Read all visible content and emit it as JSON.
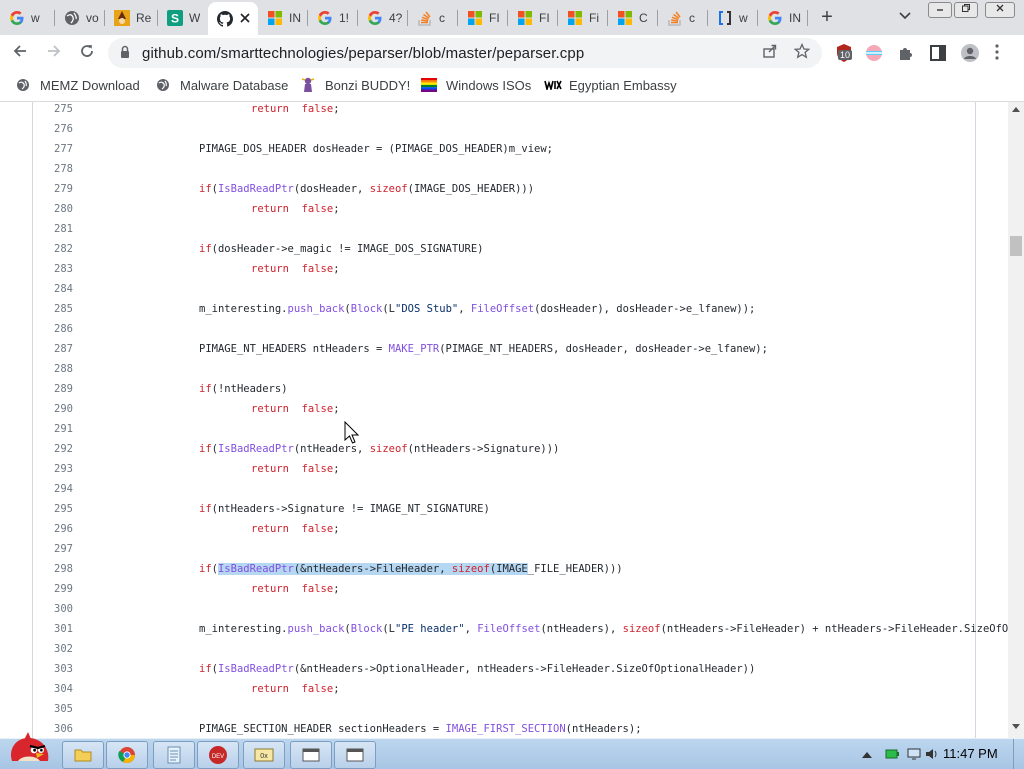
{
  "tabs": [
    {
      "title": "w",
      "icon": "google-icon",
      "active": false
    },
    {
      "title": "vo",
      "icon": "globe-icon",
      "active": false
    },
    {
      "title": "Re",
      "icon": "wizard-icon",
      "active": false
    },
    {
      "title": "W",
      "icon": "s-logo-icon",
      "active": false
    },
    {
      "title": "",
      "icon": "github-icon",
      "active": true
    },
    {
      "title": "IN",
      "icon": "windows-icon",
      "active": false
    },
    {
      "title": "1!",
      "icon": "google-icon",
      "active": false
    },
    {
      "title": "4?",
      "icon": "google-icon",
      "active": false
    },
    {
      "title": "c",
      "icon": "stackoverflow-icon",
      "active": false
    },
    {
      "title": "FI",
      "icon": "windows-icon",
      "active": false
    },
    {
      "title": "FI",
      "icon": "windows-icon",
      "active": false
    },
    {
      "title": "Fi",
      "icon": "windows-icon",
      "active": false
    },
    {
      "title": "C",
      "icon": "windows-icon",
      "active": false
    },
    {
      "title": "c",
      "icon": "stackoverflow-icon",
      "active": false
    },
    {
      "title": "w",
      "icon": "bracket-icon",
      "active": false
    },
    {
      "title": "IN",
      "icon": "google-icon",
      "active": false
    }
  ],
  "toolbar": {
    "url": "github.com/smarttechnologies/peparser/blob/master/peparser.cpp",
    "ext_badge": "10"
  },
  "bookmarks": [
    {
      "label": "MEMZ Download",
      "icon": "globe-icon"
    },
    {
      "label": "Malware Database",
      "icon": "globe-icon"
    },
    {
      "label": "Bonzi BUDDY!",
      "icon": "bonzi-icon"
    },
    {
      "label": "Windows ISOs",
      "icon": "rainbow-flag-icon"
    },
    {
      "label": "Egyptian Embassy",
      "icon": "wix-icon"
    }
  ],
  "code": {
    "lines": [
      {
        "n": "275",
        "indent": 2,
        "segs": [
          [
            "kw",
            "return"
          ],
          [
            "",
            "  "
          ],
          [
            "kw",
            "false"
          ],
          [
            "",
            ";"
          ]
        ]
      },
      {
        "n": "276",
        "indent": 0,
        "segs": []
      },
      {
        "n": "277",
        "indent": 1,
        "segs": [
          [
            "",
            "PIMAGE_DOS_HEADER dosHeader = (PIMAGE_DOS_HEADER)m_view;"
          ]
        ]
      },
      {
        "n": "278",
        "indent": 0,
        "segs": []
      },
      {
        "n": "279",
        "indent": 1,
        "segs": [
          [
            "kw",
            "if"
          ],
          [
            "",
            "("
          ],
          [
            "fn",
            "IsBadReadPtr"
          ],
          [
            "",
            "(dosHeader, "
          ],
          [
            "kw",
            "sizeof"
          ],
          [
            "",
            "(IMAGE_DOS_HEADER)))"
          ]
        ]
      },
      {
        "n": "280",
        "indent": 2,
        "segs": [
          [
            "kw",
            "return"
          ],
          [
            "",
            "  "
          ],
          [
            "kw",
            "false"
          ],
          [
            "",
            ";"
          ]
        ]
      },
      {
        "n": "281",
        "indent": 0,
        "segs": []
      },
      {
        "n": "282",
        "indent": 1,
        "segs": [
          [
            "kw",
            "if"
          ],
          [
            "",
            "(dosHeader->e_magic != IMAGE_DOS_SIGNATURE)"
          ]
        ]
      },
      {
        "n": "283",
        "indent": 2,
        "segs": [
          [
            "kw",
            "return"
          ],
          [
            "",
            "  "
          ],
          [
            "kw",
            "false"
          ],
          [
            "",
            ";"
          ]
        ]
      },
      {
        "n": "284",
        "indent": 0,
        "segs": []
      },
      {
        "n": "285",
        "indent": 1,
        "segs": [
          [
            "",
            "m_interesting."
          ],
          [
            "fn",
            "push_back"
          ],
          [
            "",
            "("
          ],
          [
            "fn",
            "Block"
          ],
          [
            "",
            "(L"
          ],
          [
            "str",
            "\"DOS Stub\""
          ],
          [
            "",
            ", "
          ],
          [
            "fn",
            "FileOffset"
          ],
          [
            "",
            "(dosHeader), dosHeader->e_lfanew));"
          ]
        ]
      },
      {
        "n": "286",
        "indent": 0,
        "segs": []
      },
      {
        "n": "287",
        "indent": 1,
        "segs": [
          [
            "",
            "PIMAGE_NT_HEADERS ntHeaders = "
          ],
          [
            "fn",
            "MAKE_PTR"
          ],
          [
            "",
            "(PIMAGE_NT_HEADERS, dosHeader, dosHeader->e_lfanew);"
          ]
        ]
      },
      {
        "n": "288",
        "indent": 0,
        "segs": []
      },
      {
        "n": "289",
        "indent": 1,
        "segs": [
          [
            "kw",
            "if"
          ],
          [
            "",
            "(!ntHeaders)"
          ]
        ]
      },
      {
        "n": "290",
        "indent": 2,
        "segs": [
          [
            "kw",
            "return"
          ],
          [
            "",
            "  "
          ],
          [
            "kw",
            "false"
          ],
          [
            "",
            ";"
          ]
        ]
      },
      {
        "n": "291",
        "indent": 0,
        "segs": []
      },
      {
        "n": "292",
        "indent": 1,
        "segs": [
          [
            "kw",
            "if"
          ],
          [
            "",
            "("
          ],
          [
            "fn",
            "IsBadReadPtr"
          ],
          [
            "",
            "(ntHeaders, "
          ],
          [
            "kw",
            "sizeof"
          ],
          [
            "",
            "(ntHeaders->Signature)))"
          ]
        ]
      },
      {
        "n": "293",
        "indent": 2,
        "segs": [
          [
            "kw",
            "return"
          ],
          [
            "",
            "  "
          ],
          [
            "kw",
            "false"
          ],
          [
            "",
            ";"
          ]
        ]
      },
      {
        "n": "294",
        "indent": 0,
        "segs": []
      },
      {
        "n": "295",
        "indent": 1,
        "segs": [
          [
            "kw",
            "if"
          ],
          [
            "",
            "(ntHeaders->Signature != IMAGE_NT_SIGNATURE)"
          ]
        ]
      },
      {
        "n": "296",
        "indent": 2,
        "segs": [
          [
            "kw",
            "return"
          ],
          [
            "",
            "  "
          ],
          [
            "kw",
            "false"
          ],
          [
            "",
            ";"
          ]
        ]
      },
      {
        "n": "297",
        "indent": 0,
        "segs": []
      },
      {
        "n": "298",
        "indent": 1,
        "segs": [
          [
            "kw",
            "if"
          ],
          [
            "",
            "("
          ],
          [
            "fn hl",
            "IsBadReadPtr"
          ],
          [
            "hl",
            "(&ntHeaders->FileHeader, "
          ],
          [
            "kw hl",
            "sizeof"
          ],
          [
            "hl",
            "(IMAGE"
          ],
          [
            "",
            "_FILE_HEADER)))"
          ]
        ]
      },
      {
        "n": "299",
        "indent": 2,
        "segs": [
          [
            "kw",
            "return"
          ],
          [
            "",
            "  "
          ],
          [
            "kw",
            "false"
          ],
          [
            "",
            ";"
          ]
        ]
      },
      {
        "n": "300",
        "indent": 0,
        "segs": []
      },
      {
        "n": "301",
        "indent": 1,
        "segs": [
          [
            "",
            "m_interesting."
          ],
          [
            "fn",
            "push_back"
          ],
          [
            "",
            "("
          ],
          [
            "fn",
            "Block"
          ],
          [
            "",
            "(L"
          ],
          [
            "str",
            "\"PE header\""
          ],
          [
            "",
            ", "
          ],
          [
            "fn",
            "FileOffset"
          ],
          [
            "",
            "(ntHeaders), "
          ],
          [
            "kw",
            "sizeof"
          ],
          [
            "",
            "(ntHeaders->FileHeader) + ntHeaders->FileHeader.SizeOfOptionalHeader"
          ]
        ]
      },
      {
        "n": "302",
        "indent": 0,
        "segs": []
      },
      {
        "n": "303",
        "indent": 1,
        "segs": [
          [
            "kw",
            "if"
          ],
          [
            "",
            "("
          ],
          [
            "fn",
            "IsBadReadPtr"
          ],
          [
            "",
            "(&ntHeaders->OptionalHeader, ntHeaders->FileHeader.SizeOfOptionalHeader))"
          ]
        ]
      },
      {
        "n": "304",
        "indent": 2,
        "segs": [
          [
            "kw",
            "return"
          ],
          [
            "",
            "  "
          ],
          [
            "kw",
            "false"
          ],
          [
            "",
            ";"
          ]
        ]
      },
      {
        "n": "305",
        "indent": 0,
        "segs": []
      },
      {
        "n": "306",
        "indent": 1,
        "segs": [
          [
            "",
            "PIMAGE_SECTION_HEADER sectionHeaders = "
          ],
          [
            "fn",
            "IMAGE_FIRST_SECTION"
          ],
          [
            "",
            "(ntHeaders);"
          ]
        ]
      }
    ]
  },
  "taskbar": {
    "clock": "11:47 PM",
    "apps": [
      {
        "name": "explorer",
        "icon": "folder-icon"
      },
      {
        "name": "chrome",
        "icon": "chrome-icon"
      },
      {
        "name": "notepad",
        "icon": "notepad-icon"
      },
      {
        "name": "devcpp",
        "icon": "devcpp-icon"
      },
      {
        "name": "hex-editor",
        "icon": "hex-icon"
      },
      {
        "name": "window-1",
        "icon": "window-icon"
      },
      {
        "name": "window-2",
        "icon": "window-icon"
      }
    ]
  },
  "colors": {
    "keyword": "#cf222e",
    "function": "#8250df",
    "string": "#0a3069",
    "selection": "#b6d7f2"
  }
}
